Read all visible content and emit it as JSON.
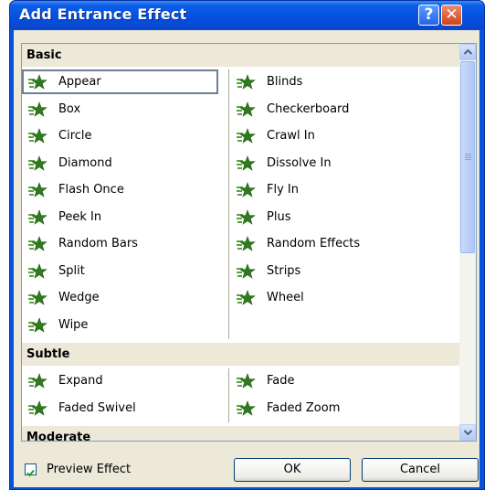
{
  "window": {
    "title": "Add Entrance Effect",
    "help_glyph": "?",
    "close_glyph": "✕"
  },
  "colors": {
    "titlebar": "#0a52d8",
    "client": "#ece9d8",
    "icon_green": "#3c8c2a",
    "icon_star": "#2f7a1f"
  },
  "categories": [
    {
      "name": "Basic",
      "left": [
        "Appear",
        "Box",
        "Circle",
        "Diamond",
        "Flash Once",
        "Peek In",
        "Random Bars",
        "Split",
        "Wedge",
        "Wipe"
      ],
      "right": [
        "Blinds",
        "Checkerboard",
        "Crawl In",
        "Dissolve In",
        "Fly In",
        "Plus",
        "Random Effects",
        "Strips",
        "Wheel"
      ]
    },
    {
      "name": "Subtle",
      "left": [
        "Expand",
        "Faded Swivel"
      ],
      "right": [
        "Fade",
        "Faded Zoom"
      ]
    },
    {
      "name": "Moderate",
      "left": [],
      "right": []
    }
  ],
  "selected_effect": "Appear",
  "preview": {
    "label": "Preview Effect",
    "checked": true
  },
  "buttons": {
    "ok": "OK",
    "cancel": "Cancel"
  }
}
